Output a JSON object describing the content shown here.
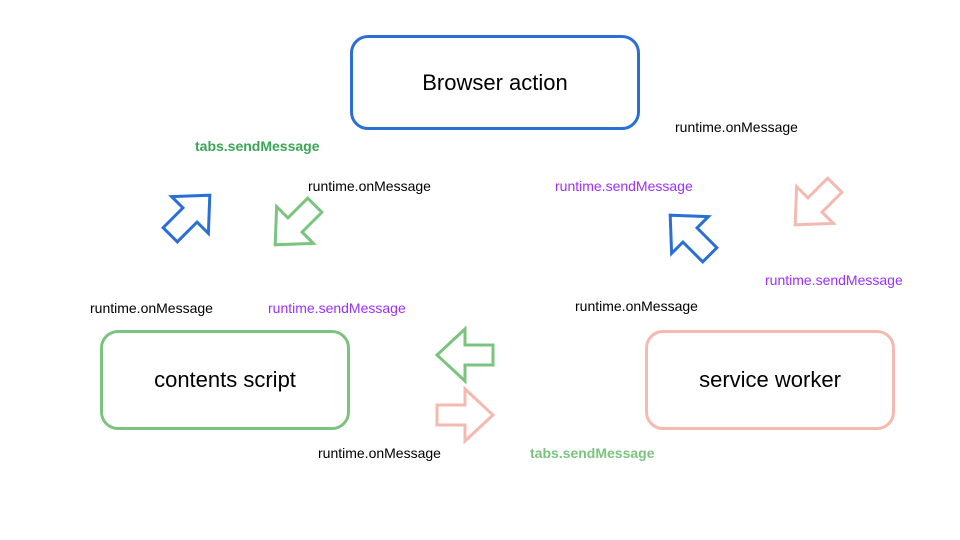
{
  "nodes": {
    "browser_action": {
      "label": "Browser action",
      "border_color": "#2a6fd6"
    },
    "contents_script": {
      "label": "contents script",
      "border_color": "#7bc47f"
    },
    "service_worker": {
      "label": "service worker",
      "border_color": "#f4b9b0"
    }
  },
  "labels": {
    "tabs_send_green_top": {
      "text": "tabs.sendMessage",
      "color": "#3aa655"
    },
    "runtime_on_top_left": {
      "text": "runtime.onMessage",
      "color": "#000000"
    },
    "runtime_send_purple_left": {
      "text": "runtime.sendMessage",
      "color": "#9b30ff"
    },
    "runtime_on_left_box": {
      "text": "runtime.onMessage",
      "color": "#000000"
    },
    "runtime_send_purple_top_right": {
      "text": "runtime.sendMessage",
      "color": "#9b30ff"
    },
    "runtime_on_top_right": {
      "text": "runtime.onMessage",
      "color": "#000000"
    },
    "runtime_on_right_box": {
      "text": "runtime.onMessage",
      "color": "#000000"
    },
    "runtime_send_purple_right": {
      "text": "runtime.sendMessage",
      "color": "#9b30ff"
    },
    "runtime_on_bottom": {
      "text": "runtime.onMessage",
      "color": "#000000"
    },
    "tabs_send_green_bottom": {
      "text": "tabs.sendMessage",
      "color": "#7bc47f"
    }
  },
  "colors": {
    "blue": "#2a6fd6",
    "green": "#7bc47f",
    "pink": "#f4b9b0",
    "purple": "#9b30ff",
    "black": "#000000"
  },
  "chart_data": {
    "type": "diagram",
    "title": "",
    "nodes": [
      {
        "id": "browser_action",
        "label": "Browser action",
        "color": "blue"
      },
      {
        "id": "contents_script",
        "label": "contents script",
        "color": "green"
      },
      {
        "id": "service_worker",
        "label": "service worker",
        "color": "pink"
      }
    ],
    "edges": [
      {
        "from": "browser_action",
        "to": "contents_script",
        "send_label": "tabs.sendMessage",
        "receive_label": "runtime.onMessage",
        "arrow_color": "blue"
      },
      {
        "from": "contents_script",
        "to": "browser_action",
        "send_label": "runtime.sendMessage",
        "receive_label": "runtime.onMessage",
        "arrow_color": "green"
      },
      {
        "from": "browser_action",
        "to": "service_worker",
        "send_label": "runtime.sendMessage",
        "receive_label": "runtime.onMessage",
        "arrow_color": "blue"
      },
      {
        "from": "service_worker",
        "to": "browser_action",
        "send_label": "runtime.sendMessage",
        "receive_label": "runtime.onMessage",
        "arrow_color": "pink"
      },
      {
        "from": "contents_script",
        "to": "service_worker",
        "send_label": "runtime.sendMessage",
        "receive_label": "runtime.onMessage",
        "arrow_color": "green"
      },
      {
        "from": "service_worker",
        "to": "contents_script",
        "send_label": "tabs.sendMessage",
        "receive_label": "runtime.onMessage",
        "arrow_color": "pink"
      }
    ]
  }
}
